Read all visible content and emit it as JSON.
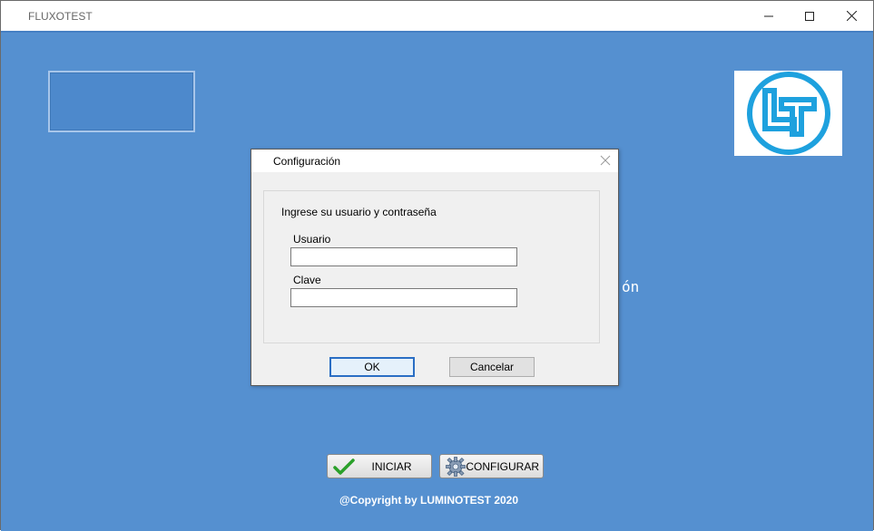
{
  "window": {
    "title": "FLUXOTEST"
  },
  "background_text": "ón",
  "buttons": {
    "start_label": "INICIAR",
    "configure_label": "CONFIGURAR"
  },
  "footer": {
    "copyright": "@Copyright by LUMINOTEST 2020"
  },
  "dialog": {
    "title": "Configuración",
    "prompt": "Ingrese su usuario y contraseña",
    "user_label": "Usuario",
    "user_value": "",
    "password_label": "Clave",
    "password_value": "",
    "ok_label": "OK",
    "cancel_label": "Cancelar"
  },
  "colors": {
    "background": "#5590d0",
    "logo_ring": "#1ea1de",
    "dialog_bg": "#f0f0f0"
  },
  "icons": [
    "minimize-icon",
    "maximize-icon",
    "close-icon",
    "checkmark-icon",
    "gear-icon",
    "logo-lt-icon",
    "dialog-close-icon"
  ]
}
